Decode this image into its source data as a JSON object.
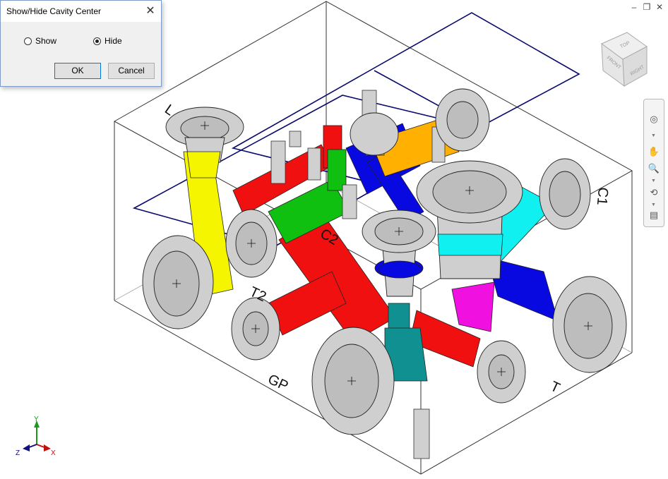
{
  "dialog": {
    "title": "Show/Hide Cavity Center",
    "close_glyph": "✕",
    "options": [
      {
        "label": "Show",
        "selected": false
      },
      {
        "label": "Hide",
        "selected": true
      }
    ],
    "ok_label": "OK",
    "cancel_label": "Cancel"
  },
  "window_controls": {
    "minimize": "–",
    "restore": "❐",
    "close": "✕"
  },
  "viewcube": {
    "faces": {
      "top": "TOP",
      "front": "FRONT",
      "right": "RIGHT"
    }
  },
  "nav_tools": [
    {
      "name": "steering-wheel-icon",
      "glyph": "◎"
    },
    {
      "name": "pan-icon",
      "glyph": "✋"
    },
    {
      "name": "zoom-icon",
      "glyph": "🔍"
    },
    {
      "name": "orbit-icon",
      "glyph": "⟲"
    },
    {
      "name": "look-at-icon",
      "glyph": "▤"
    }
  ],
  "port_labels": [
    {
      "id": "L",
      "text": "L"
    },
    {
      "id": "C1",
      "text": "C1"
    },
    {
      "id": "C2",
      "text": "C2"
    },
    {
      "id": "T2",
      "text": "T2"
    },
    {
      "id": "GP",
      "text": "GP"
    },
    {
      "id": "T",
      "text": "T"
    }
  ],
  "axis_triad": {
    "x": "X",
    "y": "Y",
    "z": "Z"
  },
  "colors": {
    "outline": "#1a1a1a",
    "cavity_plane": "#0a0a6e",
    "port_gray": "#cfcfcf",
    "yellow": "#f5f500",
    "red": "#f01010",
    "green": "#10c010",
    "blue": "#0808e0",
    "orange": "#ffb000",
    "cyan": "#10f0f0",
    "magenta": "#f010e0",
    "teal": "#109090"
  }
}
